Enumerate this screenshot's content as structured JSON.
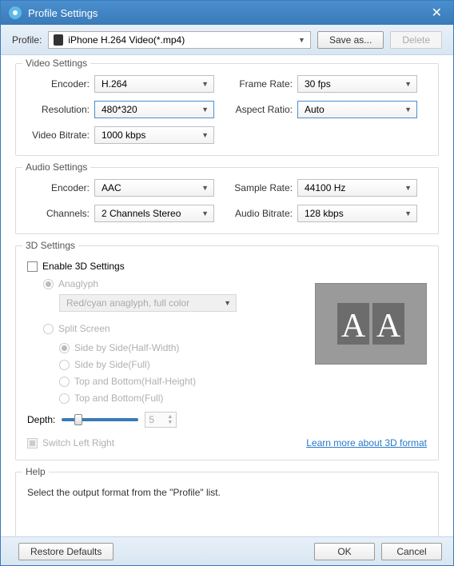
{
  "window": {
    "title": "Profile Settings"
  },
  "profile_bar": {
    "label": "Profile:",
    "selected": "iPhone H.264 Video(*.mp4)",
    "save_as": "Save as...",
    "delete": "Delete"
  },
  "video_settings": {
    "legend": "Video Settings",
    "encoder_label": "Encoder:",
    "encoder_value": "H.264",
    "resolution_label": "Resolution:",
    "resolution_value": "480*320",
    "video_bitrate_label": "Video Bitrate:",
    "video_bitrate_value": "1000 kbps",
    "frame_rate_label": "Frame Rate:",
    "frame_rate_value": "30 fps",
    "aspect_ratio_label": "Aspect Ratio:",
    "aspect_ratio_value": "Auto"
  },
  "audio_settings": {
    "legend": "Audio Settings",
    "encoder_label": "Encoder:",
    "encoder_value": "AAC",
    "channels_label": "Channels:",
    "channels_value": "2 Channels Stereo",
    "sample_rate_label": "Sample Rate:",
    "sample_rate_value": "44100 Hz",
    "audio_bitrate_label": "Audio Bitrate:",
    "audio_bitrate_value": "128 kbps"
  },
  "three_d": {
    "legend": "3D Settings",
    "enable_label": "Enable 3D Settings",
    "anaglyph_label": "Anaglyph",
    "anaglyph_value": "Red/cyan anaglyph, full color",
    "split_screen_label": "Split Screen",
    "option_sbs_half": "Side by Side(Half-Width)",
    "option_sbs_full": "Side by Side(Full)",
    "option_tb_half": "Top and Bottom(Half-Height)",
    "option_tb_full": "Top and Bottom(Full)",
    "depth_label": "Depth:",
    "depth_value": "5",
    "switch_label": "Switch Left Right",
    "learn_link": "Learn more about 3D format"
  },
  "help": {
    "legend": "Help",
    "text": "Select the output format from the \"Profile\" list."
  },
  "footer": {
    "restore": "Restore Defaults",
    "ok": "OK",
    "cancel": "Cancel"
  }
}
